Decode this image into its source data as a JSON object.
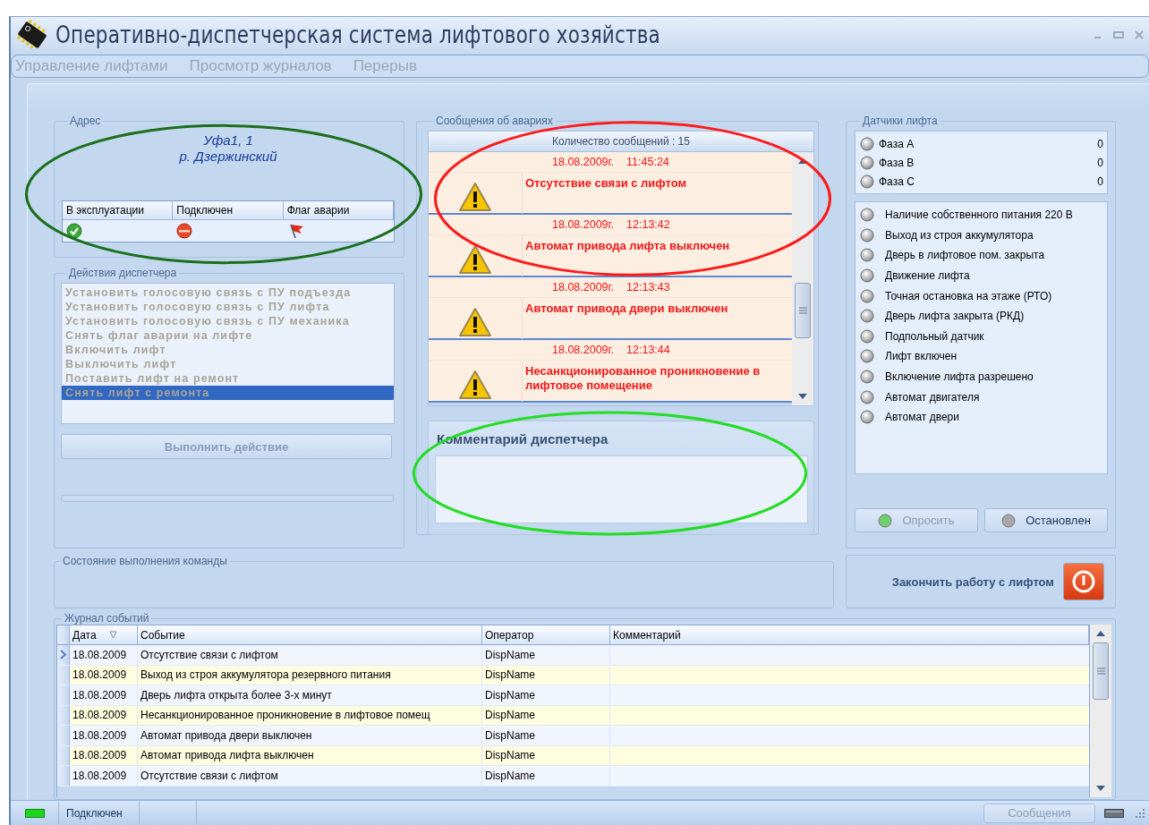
{
  "window": {
    "title": "Оперативно-диспетчерская система лифтового хозяйства"
  },
  "menu": [
    {
      "label": "Управление лифтами",
      "disabled": true
    },
    {
      "label": "Просмотр журналов",
      "disabled": true
    },
    {
      "label": "Перерыв",
      "disabled": true
    }
  ],
  "address": {
    "legend": "Адрес",
    "lines": [
      "Уфа1, 1",
      "р. Дзержинский"
    ],
    "columns": [
      {
        "label": "В эксплуатации",
        "kind": "check"
      },
      {
        "label": "Подключен",
        "kind": "stop"
      },
      {
        "label": "Флаг аварии",
        "kind": "flag"
      }
    ]
  },
  "actions": {
    "legend": "Действия диспетчера",
    "disabled": true,
    "items": [
      {
        "label": "Установить голосовую связь с ПУ подъезда",
        "selected": false
      },
      {
        "label": "Установить голосовую связь с ПУ лифта",
        "selected": false
      },
      {
        "label": "Установить голосовую связь с ПУ механика",
        "selected": false
      },
      {
        "label": "Снять флаг аварии на лифте",
        "selected": false
      },
      {
        "label": "Включить лифт",
        "selected": false
      },
      {
        "label": "Выключить лифт",
        "selected": false
      },
      {
        "label": "Поставить лифт на ремонт",
        "selected": false
      },
      {
        "label": "Снять лифт с ремонта",
        "selected": true
      }
    ],
    "button": {
      "label": "Выполнить действие",
      "disabled": true
    },
    "progress": {
      "level": 0
    }
  },
  "alarms": {
    "legend": "Сообщения об авариях",
    "count": "Количество сообщений : 15",
    "messages": [
      {
        "date": "18.08.2009г.",
        "time": "11:45:24",
        "text": "Отсутствие связи с лифтом"
      },
      {
        "date": "18.08.2009г.",
        "time": "12:13:42",
        "text": "Автомат привода лифта выключен"
      },
      {
        "date": "18.08.2009г.",
        "time": "12:13:43",
        "text": "Автомат привода двери выключен"
      },
      {
        "date": "18.08.2009г.",
        "time": "12:13:44",
        "text": "Несанкционированное проникновение в лифтовое помещение"
      }
    ]
  },
  "comment": {
    "title": "Комментарий диспетчера"
  },
  "sensors": {
    "legend": "Датчики лифта",
    "phases": [
      {
        "name": "Фаза А",
        "value": "0",
        "on": false
      },
      {
        "name": "Фаза В",
        "value": "0",
        "on": false
      },
      {
        "name": "Фаза С",
        "value": "0",
        "on": false
      }
    ],
    "items": [
      {
        "name": "Наличие собственного питания 220 В",
        "on": false
      },
      {
        "name": "Выход из строя аккумулятора",
        "on": false
      },
      {
        "name": "Дверь в лифтовое пом. закрыта",
        "on": false
      },
      {
        "name": "Движение лифта",
        "on": false
      },
      {
        "name": "Точная остановка на этаже (РТО)",
        "on": false
      },
      {
        "name": "Дверь лифта закрыта (РКД)",
        "on": false
      },
      {
        "name": "Подпольный датчик",
        "on": false
      },
      {
        "name": "Лифт включен",
        "on": false
      },
      {
        "name": "Включение лифта разрешено",
        "on": false
      },
      {
        "name": "Автомат двигателя",
        "on": false
      },
      {
        "name": "Автомат двери",
        "on": false
      }
    ],
    "buttons": [
      {
        "label": "Опросить",
        "disabled": true,
        "color": "#6fcf6f"
      },
      {
        "label": "Остановлен",
        "disabled": false,
        "color": "#a8a8a8"
      }
    ]
  },
  "command_state": {
    "legend": "Состояние выполнения команды"
  },
  "finish": {
    "label": "Закончить работу с лифтом"
  },
  "journal": {
    "legend": "Журнал событий",
    "columns": [
      {
        "label": "Дата",
        "sorted": true
      },
      {
        "label": "Событие",
        "sorted": false
      },
      {
        "label": "Оператор",
        "sorted": false
      },
      {
        "label": "Комментарий",
        "sorted": false
      }
    ],
    "rows": [
      {
        "cells": [
          "18.08.2009",
          "Отсутствие связи с лифтом",
          "DispName"
        ],
        "selected": true
      },
      {
        "cells": [
          "18.08.2009",
          "Выход из строя аккумулятора резервного питания",
          "DispName"
        ],
        "selected": false
      },
      {
        "cells": [
          "18.08.2009",
          "Дверь лифта открыта более 3-х минут",
          "DispName"
        ],
        "selected": false
      },
      {
        "cells": [
          "18.08.2009",
          "Несанкционированное проникновение в лифтовое помещ",
          "DispName"
        ],
        "selected": false
      },
      {
        "cells": [
          "18.08.2009",
          "Автомат привода двери выключен",
          "DispName"
        ],
        "selected": false
      },
      {
        "cells": [
          "18.08.2009",
          "Автомат привода лифта выключен",
          "DispName"
        ],
        "selected": false
      },
      {
        "cells": [
          "18.08.2009",
          "Отсутствие связи с лифтом",
          "DispName"
        ],
        "selected": false
      }
    ]
  },
  "status_bar": {
    "connection": "Подключен",
    "connected": true,
    "messages_button": {
      "label": "Сообщения",
      "disabled": true
    }
  },
  "annotations": [
    {
      "kind": "address",
      "color": "#1b6e1b"
    },
    {
      "kind": "alarms",
      "color": "#ff1a1a"
    },
    {
      "kind": "comment",
      "color": "#22dd22"
    }
  ]
}
